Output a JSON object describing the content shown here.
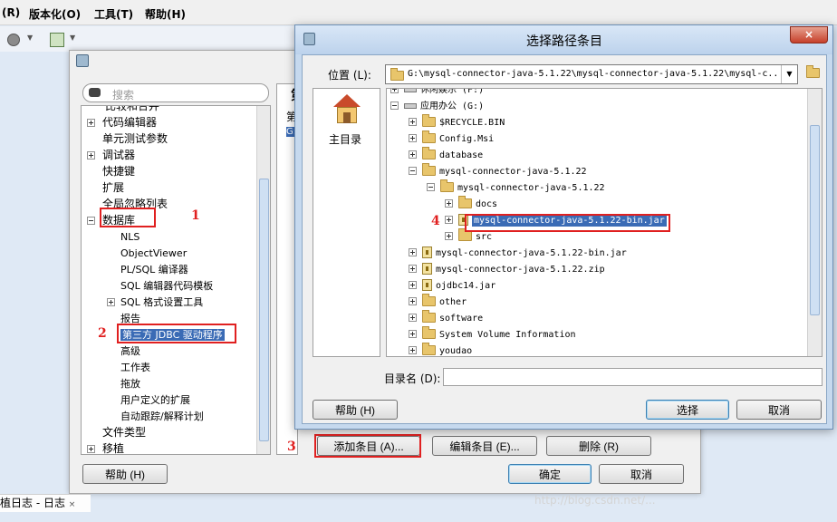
{
  "menubar": {
    "items": [
      "(R)",
      "版本化(O)",
      "工具(T)",
      "帮助(H)"
    ]
  },
  "prefs": {
    "search_placeholder": "搜索",
    "cut_top_label": "比较和合并",
    "tree": [
      {
        "label": "代码编辑器",
        "level": 0,
        "expander": "plus"
      },
      {
        "label": "单元测试参数",
        "level": 0,
        "expander": "none"
      },
      {
        "label": "调试器",
        "level": 0,
        "expander": "plus"
      },
      {
        "label": "快捷键",
        "level": 0,
        "expander": "none"
      },
      {
        "label": "扩展",
        "level": 0,
        "expander": "none"
      },
      {
        "label": "全局忽略列表",
        "level": 0,
        "expander": "none"
      },
      {
        "label": "数据库",
        "level": 0,
        "expander": "minus"
      },
      {
        "label": "NLS",
        "level": 1,
        "expander": "none"
      },
      {
        "label": "ObjectViewer",
        "level": 1,
        "expander": "none"
      },
      {
        "label": "PL/SQL 编译器",
        "level": 1,
        "expander": "none"
      },
      {
        "label": "SQL 编辑器代码模板",
        "level": 1,
        "expander": "none"
      },
      {
        "label": "SQL 格式设置工具",
        "level": 1,
        "expander": "plus"
      },
      {
        "label": "报告",
        "level": 1,
        "expander": "none"
      },
      {
        "label": "第三方 JDBC 驱动程序",
        "level": 1,
        "expander": "none",
        "selected": true
      },
      {
        "label": "高级",
        "level": 1,
        "expander": "none"
      },
      {
        "label": "工作表",
        "level": 1,
        "expander": "none"
      },
      {
        "label": "拖放",
        "level": 1,
        "expander": "none"
      },
      {
        "label": "用户定义的扩展",
        "level": 1,
        "expander": "none"
      },
      {
        "label": "自动跟踪/解释计划",
        "level": 1,
        "expander": "none"
      },
      {
        "label": "文件类型",
        "level": 0,
        "expander": "none"
      },
      {
        "label": "移植",
        "level": 0,
        "expander": "plus"
      }
    ],
    "right_header": "第",
    "right_sub": "第",
    "right_item": "G:",
    "help_btn": "帮助 (H)",
    "add_btn": "添加条目 (A)...",
    "edit_btn": "编辑条目 (E)...",
    "delete_btn": "删除 (R)",
    "ok_btn": "确定",
    "cancel_btn": "取消"
  },
  "annotations": [
    "1",
    "2",
    "3",
    "4"
  ],
  "dialog": {
    "title": "选择路径条目",
    "location_label": "位置 (L):",
    "location_value": "G:\\mysql-connector-java-5.1.22\\mysql-connector-java-5.1.22\\mysql-c...",
    "home_label": "主目录",
    "tree": [
      {
        "label": "休闲娱乐 (F:)",
        "indent": 0,
        "expander": "plus",
        "icon": "drive"
      },
      {
        "label": "应用办公 (G:)",
        "indent": 0,
        "expander": "minus",
        "icon": "drive"
      },
      {
        "label": "$RECYCLE.BIN",
        "indent": 1,
        "expander": "plus",
        "icon": "folder"
      },
      {
        "label": "Config.Msi",
        "indent": 1,
        "expander": "plus",
        "icon": "folder"
      },
      {
        "label": "database",
        "indent": 1,
        "expander": "plus",
        "icon": "folder"
      },
      {
        "label": "mysql-connector-java-5.1.22",
        "indent": 1,
        "expander": "minus",
        "icon": "folder"
      },
      {
        "label": "mysql-connector-java-5.1.22",
        "indent": 2,
        "expander": "minus",
        "icon": "folder"
      },
      {
        "label": "docs",
        "indent": 3,
        "expander": "plus",
        "icon": "folder"
      },
      {
        "label": "mysql-connector-java-5.1.22-bin.jar",
        "indent": 3,
        "expander": "plus",
        "icon": "jar",
        "selected": true
      },
      {
        "label": "src",
        "indent": 3,
        "expander": "plus",
        "icon": "folder"
      },
      {
        "label": "mysql-connector-java-5.1.22-bin.jar",
        "indent": 1,
        "expander": "plus",
        "icon": "jar"
      },
      {
        "label": "mysql-connector-java-5.1.22.zip",
        "indent": 1,
        "expander": "plus",
        "icon": "jar"
      },
      {
        "label": "ojdbc14.jar",
        "indent": 1,
        "expander": "plus",
        "icon": "jar"
      },
      {
        "label": "other",
        "indent": 1,
        "expander": "plus",
        "icon": "folder"
      },
      {
        "label": "software",
        "indent": 1,
        "expander": "plus",
        "icon": "folder"
      },
      {
        "label": "System Volume Information",
        "indent": 1,
        "expander": "plus",
        "icon": "folder"
      },
      {
        "label": "youdao",
        "indent": 1,
        "expander": "plus",
        "icon": "folder"
      }
    ],
    "dirname_label": "目录名 (D):",
    "dirname_value": "",
    "help_btn": "帮助 (H)",
    "select_btn": "选择",
    "cancel_btn": "取消"
  },
  "bottom_tab": "植日志 - 日志",
  "watermark": "http://blog.csdn.net/..."
}
